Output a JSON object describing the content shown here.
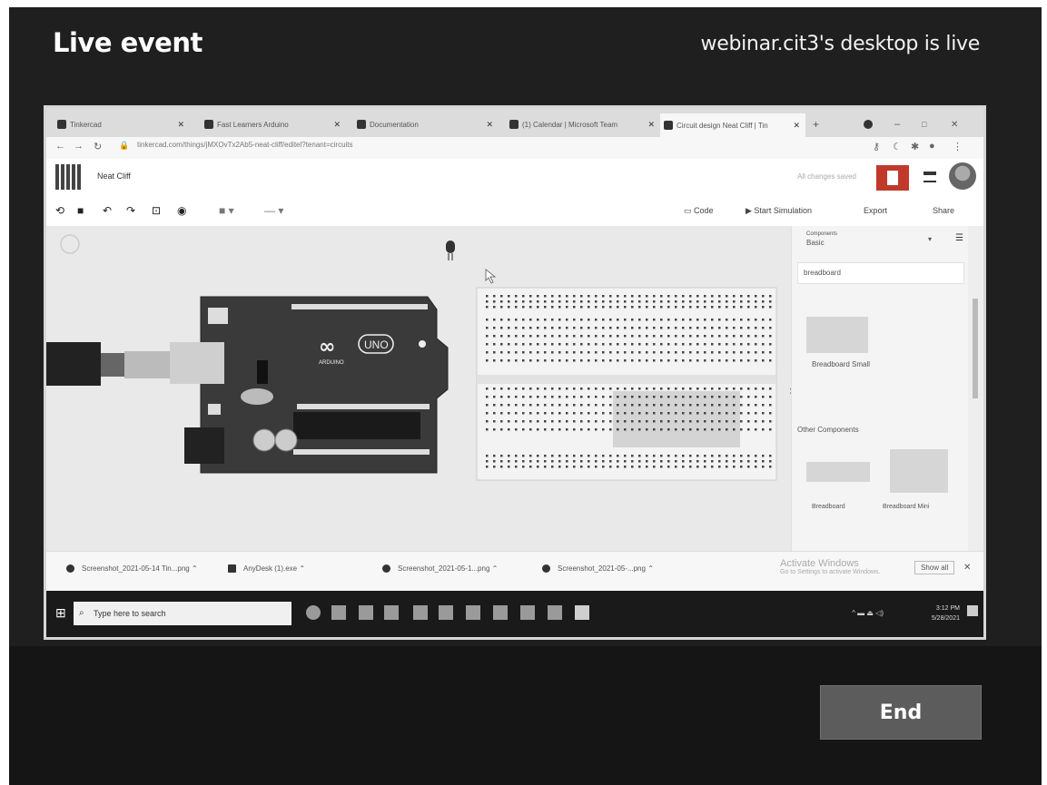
{
  "header": {
    "title": "Live event",
    "status": "webinar.cit3's desktop is live"
  },
  "controls": {
    "end_label": "End"
  },
  "shared_screen": {
    "browser_tabs": [
      {
        "label": "Tinkercad"
      },
      {
        "label": "Fast Learners Arduino"
      },
      {
        "label": "Documentation"
      },
      {
        "label": "(1) Calendar | Microsoft Team"
      },
      {
        "label": "Circuit design Neat Cliff | Tin"
      }
    ],
    "url": "tinkercad.com/things/jMXOvTx2Ab5-neat-cliff/editel?tenant=circuits",
    "app_name": "Neat Cliff",
    "saved_status": "All changes saved",
    "toolbar_right": {
      "code": "Code",
      "simulate": "Start Simulation",
      "export": "Export",
      "share": "Share"
    },
    "components_panel": {
      "dropdown_label": "Components",
      "dropdown_value": "Basic",
      "search_value": "breadboard",
      "items": [
        "Breadboard Small"
      ],
      "other_heading": "Other Components",
      "other_items": [
        "Breadboard",
        "Breadboard Mini"
      ]
    },
    "arduino_board": {
      "logo": "UNO",
      "brand": "ARDUINO"
    },
    "downloads": [
      {
        "label": "Screenshot_2021-05-14 Tin...png"
      },
      {
        "label": "AnyDesk (1).exe"
      },
      {
        "label": "Screenshot_2021-05-1...png"
      },
      {
        "label": "Screenshot_2021-05-...png"
      }
    ],
    "show_all": "Show all",
    "activate_windows": {
      "title": "Activate Windows",
      "subtitle": "Go to Settings to activate Windows."
    },
    "taskbar": {
      "search_placeholder": "Type here to search",
      "time": "3:12 PM",
      "date": "5/28/2021"
    }
  }
}
